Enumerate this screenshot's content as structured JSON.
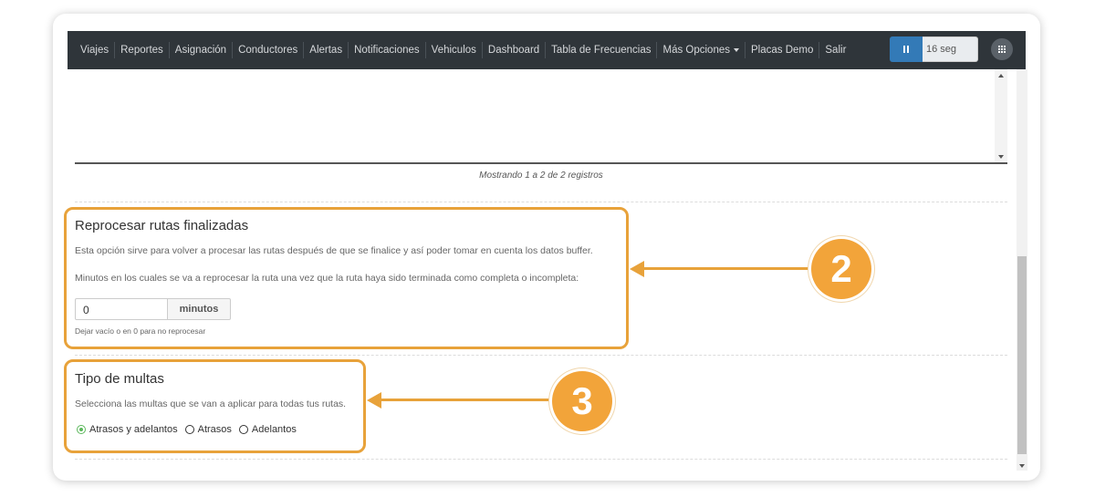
{
  "navbar": {
    "items": [
      "Viajes",
      "Reportes",
      "Asignación",
      "Conductores",
      "Alertas",
      "Notificaciones",
      "Vehiculos",
      "Dashboard",
      "Tabla de Frecuencias",
      "Más Opciones",
      "Placas Demo",
      "Salir"
    ],
    "refresh_value": "16 seg",
    "icons": [
      "pause-icon",
      "apps-grid-icon",
      "caret-down-icon"
    ]
  },
  "table": {
    "records_text": "Mostrando 1 a 2 de 2 registros"
  },
  "reprocess": {
    "title": "Reprocesar rutas finalizadas",
    "description": "Esta opción sirve para volver a procesar las rutas después de que se finalice y así poder tomar en cuenta los datos buffer.",
    "minutes_label": "Minutos en los cuales se va a reprocesar la ruta una vez que la ruta haya sido terminada como completa o incompleta:",
    "input_value": "0",
    "addon": "minutos",
    "helper": "Dejar vacío o en 0 para no reprocesar"
  },
  "fines": {
    "title": "Tipo de multas",
    "description": "Selecciona las multas que se van a aplicar para todas tus rutas.",
    "options": [
      "Atrasos y adelantos",
      "Atrasos",
      "Adelantos"
    ],
    "selected": "Atrasos y adelantos"
  },
  "callouts": {
    "badge_2": "2",
    "badge_3": "3"
  },
  "colors": {
    "highlight": "#e8a23a",
    "navbar": "#2f353a",
    "primary": "#337ab7",
    "radio_checked": "#5cb85c"
  }
}
